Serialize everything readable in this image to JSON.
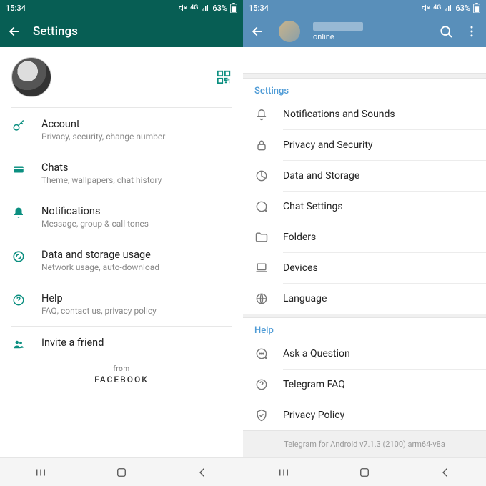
{
  "left": {
    "time": "15:34",
    "battery": "63%",
    "title": "Settings",
    "items": [
      {
        "label": "Account",
        "sub": "Privacy, security, change number"
      },
      {
        "label": "Chats",
        "sub": "Theme, wallpapers, chat history"
      },
      {
        "label": "Notifications",
        "sub": "Message, group & call tones"
      },
      {
        "label": "Data and storage usage",
        "sub": "Network usage, auto-download"
      },
      {
        "label": "Help",
        "sub": "FAQ, contact us, privacy policy"
      }
    ],
    "invite": "Invite a friend",
    "from": "from",
    "brand": "FACEBOOK"
  },
  "right": {
    "time": "15:34",
    "battery": "63%",
    "status": "online",
    "settings_header": "Settings",
    "help_header": "Help",
    "settings": [
      "Notifications and Sounds",
      "Privacy and Security",
      "Data and Storage",
      "Chat Settings",
      "Folders",
      "Devices",
      "Language"
    ],
    "help": [
      "Ask a Question",
      "Telegram FAQ",
      "Privacy Policy"
    ],
    "version": "Telegram for Android v7.1.3 (2100) arm64-v8a"
  }
}
